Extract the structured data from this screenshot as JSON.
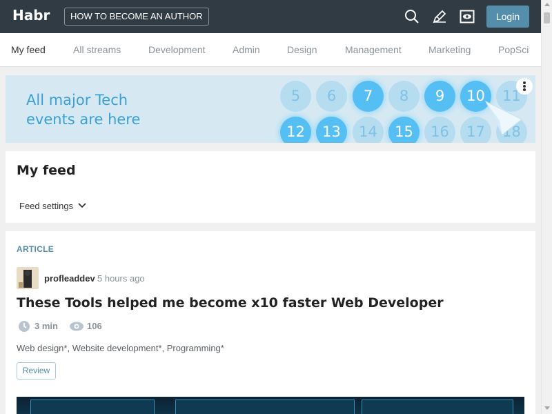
{
  "header": {
    "logo": "Habr",
    "author_button": "HOW TO BECOME AN AUTHOR",
    "icons": [
      "search-icon",
      "pen-icon",
      "eye-icon"
    ],
    "login_button": "Login"
  },
  "nav": {
    "items": [
      {
        "label": "My feed",
        "active": true
      },
      {
        "label": "All streams"
      },
      {
        "label": "Development"
      },
      {
        "label": "Admin"
      },
      {
        "label": "Design"
      },
      {
        "label": "Management"
      },
      {
        "label": "Marketing"
      },
      {
        "label": "PopSci"
      }
    ]
  },
  "banner": {
    "line1": "All major Tech",
    "line2": "events are here",
    "numbers": [
      "5",
      "6",
      "7",
      "8",
      "9",
      "10",
      "11",
      "12",
      "13",
      "14",
      "15",
      "16",
      "17",
      "18"
    ]
  },
  "feed": {
    "title": "My feed",
    "settings": "Feed settings"
  },
  "article": {
    "type": "ARTICLE",
    "author": "profleaddev",
    "time": "5 hours ago",
    "title": "These Tools helped me become x10 faster Web Developer",
    "reading_time": "3 min",
    "views": "106",
    "tags": "Web design*, Website development*, Programming*",
    "review_button": "Review"
  },
  "colors": {
    "header_bg": "#303b44",
    "accent": "#548eaa",
    "banner_bg": "#d6e9f3"
  }
}
